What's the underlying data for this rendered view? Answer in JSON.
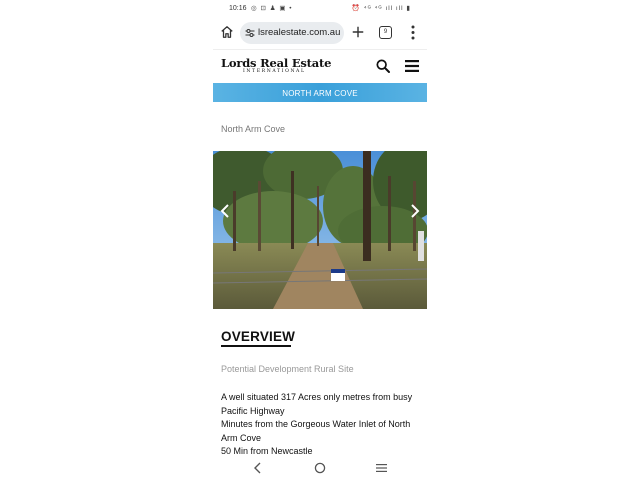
{
  "status_bar": {
    "time": "10:16",
    "left_icons": "◎ ⊡ ♟ ▣ •",
    "right_icons": "⏰ ⁴ᴳ ⁴ᴳ ıll ıll ▮"
  },
  "browser": {
    "url": "lsrealestate.com.au",
    "tab_count": "9",
    "icons": [
      "home-icon",
      "tune-icon",
      "plus-icon",
      "tabs-icon",
      "more-vert-icon"
    ]
  },
  "site": {
    "logo_name": "Lords Real Estate",
    "logo_sub": "INTERNATIONAL",
    "banner": "NORTH ARM COVE"
  },
  "listing": {
    "location": "North Arm Cove",
    "heading": "OVERVIEW",
    "subtitle": "Potential Development Rural Site",
    "description": [
      "A well situated 317 Acres only metres from busy Pacific Highway",
      "Minutes from the Gorgeous Water Inlet of North Arm Cove",
      "50 Min from Newcastle"
    ]
  },
  "colors": {
    "banner": "#3aa0da",
    "url_pill": "#e9ecef",
    "muted_text": "#999999"
  }
}
